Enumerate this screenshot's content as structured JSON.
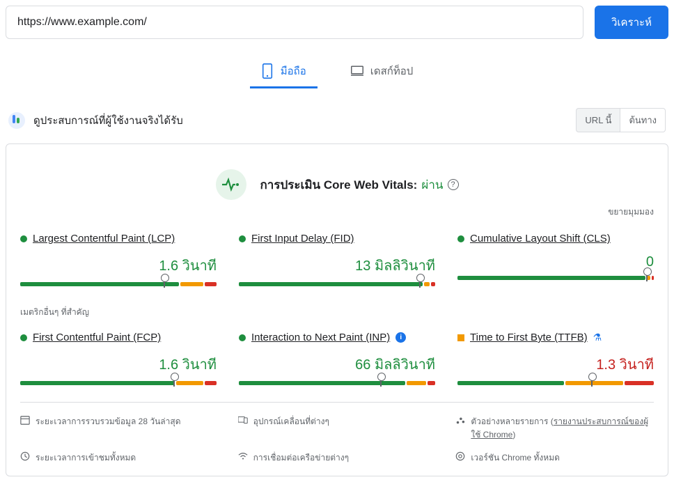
{
  "topbar": {
    "url_value": "https://www.example.com/",
    "analyze_label": "วิเคราะห์"
  },
  "tabs": {
    "mobile": "มือถือ",
    "desktop": "เดสก์ท็อป"
  },
  "header": {
    "title": "ดูประสบการณ์ที่ผู้ใช้งานจริงได้รับ",
    "chip_url": "URL นี้",
    "chip_origin": "ต้นทาง"
  },
  "assessment": {
    "label": "การประเมิน Core Web Vitals:",
    "result": "ผ่าน",
    "expand": "ขยายมุมมอง"
  },
  "other_metrics_label": "เมตริกอื่นๆ ที่สำคัญ",
  "metrics": {
    "lcp": {
      "name": "Largest Contentful Paint (LCP)",
      "value": "1.6 วินาที"
    },
    "fid": {
      "name": "First Input Delay (FID)",
      "value": "13 มิลลิวินาที"
    },
    "cls": {
      "name": "Cumulative Layout Shift (CLS)",
      "value": "0"
    },
    "fcp": {
      "name": "First Contentful Paint (FCP)",
      "value": "1.6 วินาที"
    },
    "inp": {
      "name": "Interaction to Next Paint (INP)",
      "value": "66 มิลลิวินาที"
    },
    "ttfb": {
      "name": "Time to First Byte (TTFB)",
      "value": "1.3 วินาที"
    }
  },
  "footer": {
    "period": "ระยะเวลาการรวบรวมข้อมูล 28 วันล่าสุด",
    "devices": "อุปกรณ์เคลื่อนที่ต่างๆ",
    "samples": "ตัวอย่างหลายรายการ",
    "samples_link": "รายงานประสบการณ์ของผู้ใช้ Chrome",
    "sessions": "ระยะเวลาการเข้าชมทั้งหมด",
    "networks": "การเชื่อมต่อเครือข่ายต่างๆ",
    "versions": "เวอร์ชัน Chrome ทั้งหมด"
  }
}
